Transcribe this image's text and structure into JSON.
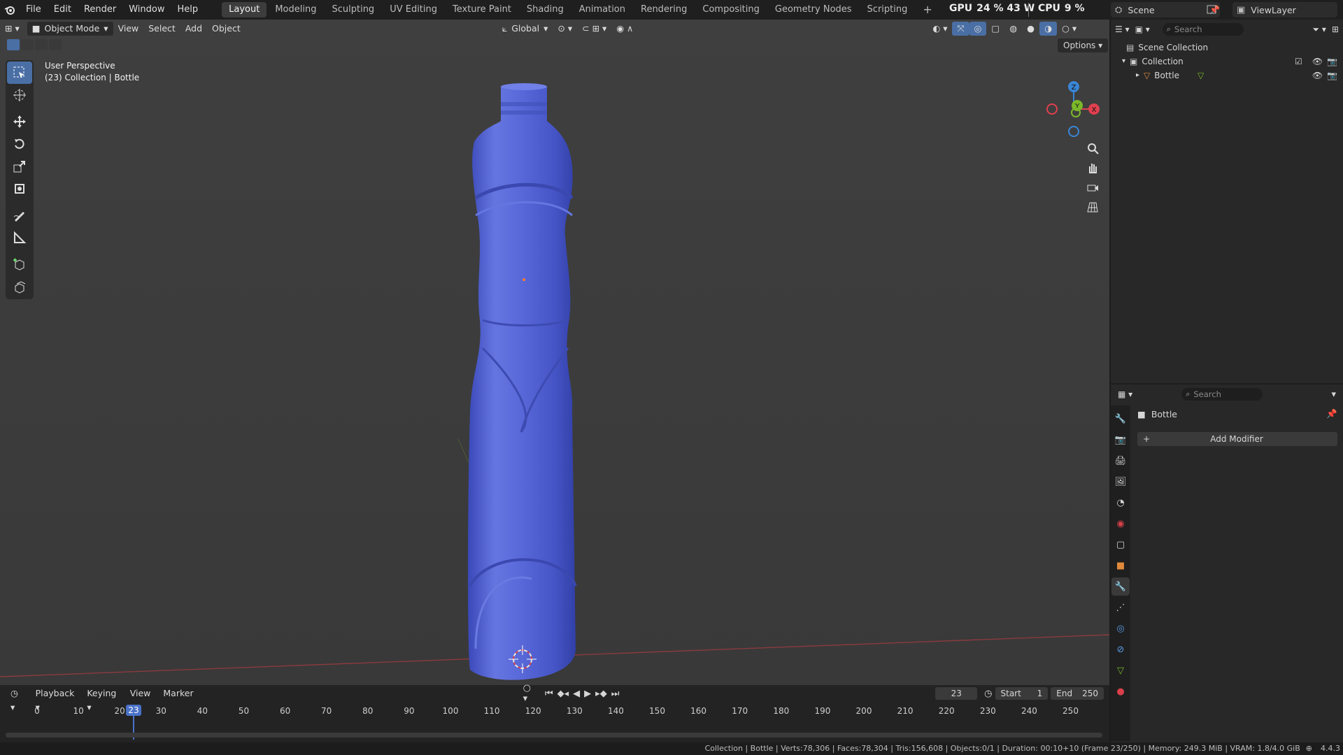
{
  "menu": [
    "File",
    "Edit",
    "Render",
    "Window",
    "Help"
  ],
  "workspaces": [
    "Layout",
    "Modeling",
    "Sculpting",
    "UV Editing",
    "Texture Paint",
    "Shading",
    "Animation",
    "Rendering",
    "Compositing",
    "Geometry Nodes",
    "Scripting"
  ],
  "active_workspace": "Layout",
  "top_right": {
    "gpu_label": "GPU",
    "gpu_value": "24 % 43 W",
    "cpu_label": "CPU",
    "cpu_value": "9 %",
    "scene": "Scene",
    "view_layer": "ViewLayer"
  },
  "viewport_header": {
    "mode": "Object Mode",
    "menus": [
      "View",
      "Select",
      "Add",
      "Object"
    ],
    "orientation": "Global",
    "options": "Options"
  },
  "viewport_overlay": {
    "perspective": "User Perspective",
    "context": "(23) Collection | Bottle"
  },
  "gizmo": {
    "x": "X",
    "y": "Y",
    "z": "Z"
  },
  "outliner": {
    "search_placeholder": "Search",
    "scene_collection": "Scene Collection",
    "collection": "Collection",
    "object": "Bottle"
  },
  "properties": {
    "search_placeholder": "Search",
    "object_name": "Bottle",
    "add_modifier": "Add Modifier"
  },
  "timeline": {
    "menus": [
      "Playback",
      "Keying",
      "View",
      "Marker"
    ],
    "current_frame": "23",
    "start_label": "Start",
    "start_value": "1",
    "end_label": "End",
    "end_value": "250",
    "ticks": [
      "0",
      "10",
      "20",
      "30",
      "40",
      "50",
      "60",
      "70",
      "80",
      "90",
      "100",
      "110",
      "120",
      "130",
      "140",
      "150",
      "160",
      "170",
      "180",
      "190",
      "200",
      "210",
      "220",
      "230",
      "240",
      "250"
    ]
  },
  "status": "Collection | Bottle | Verts:78,306 | Faces:78,304 | Tris:156,608 | Objects:0/1 | Duration: 00:10+10 (Frame 23/250) | Memory: 249.3 MiB | VRAM: 1.8/4.0 GiB",
  "version": "4.4.3",
  "colors": {
    "bottle": "#5667d6",
    "active_tool": "#4a6fa5",
    "x_axis": "#e0404f",
    "y_axis": "#7cb82a",
    "z_axis": "#3a86d6"
  }
}
